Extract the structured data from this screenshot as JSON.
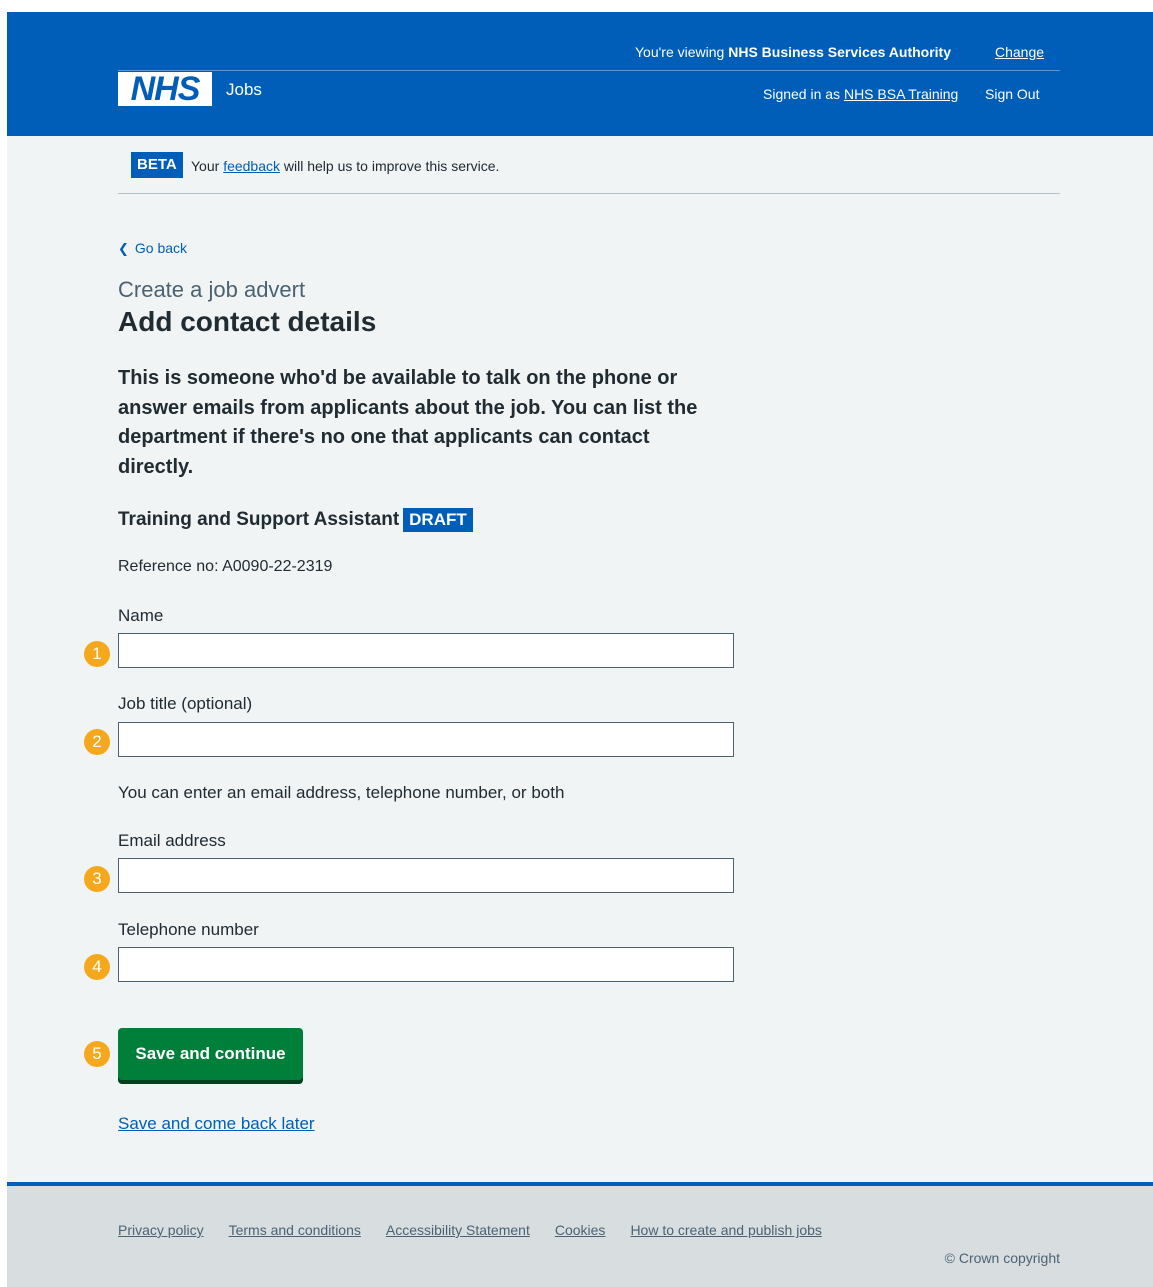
{
  "header": {
    "viewing_prefix": "You're viewing ",
    "viewing_org": "NHS Business Services Authority",
    "change_label": "Change",
    "logo_text": "NHS",
    "service_name": "Jobs",
    "signed_in_prefix": "Signed in as ",
    "signed_in_user": "NHS BSA Training",
    "sign_out_label": "Sign Out"
  },
  "beta": {
    "tag": "BETA",
    "text_before": "Your ",
    "link_text": "feedback",
    "text_after": " will help us to improve this service."
  },
  "main": {
    "back_label": "Go back",
    "caption": "Create a job advert",
    "title": "Add contact details",
    "lead": "This is someone who'd be available to talk on the phone or answer emails from applicants about the job. You can list the department if there's no one that applicants can contact directly.",
    "job_name": "Training and Support Assistant",
    "status_tag": "DRAFT",
    "reference": "Reference no: A0090-22-2319",
    "fields": [
      {
        "label": "Name",
        "value": "",
        "marker": "1"
      },
      {
        "label": "Job title (optional)",
        "value": "",
        "marker": "2"
      },
      {
        "label": "Email address",
        "value": "",
        "marker": "3"
      },
      {
        "label": "Telephone number",
        "value": "",
        "marker": "4"
      }
    ],
    "hint": "You can enter an email address, telephone number, or both",
    "submit_label": "Save and continue",
    "submit_marker": "5",
    "later_label": "Save and come back later"
  },
  "footer": {
    "links": [
      "Privacy policy",
      "Terms and conditions",
      "Accessibility Statement",
      "Cookies",
      "How to create and publish jobs"
    ],
    "copyright": "© Crown copyright"
  },
  "colors": {
    "nhs_blue": "#005eb8",
    "button_green": "#007f3b",
    "marker_orange": "#f5a81b",
    "page_bg": "#f0f4f5"
  }
}
